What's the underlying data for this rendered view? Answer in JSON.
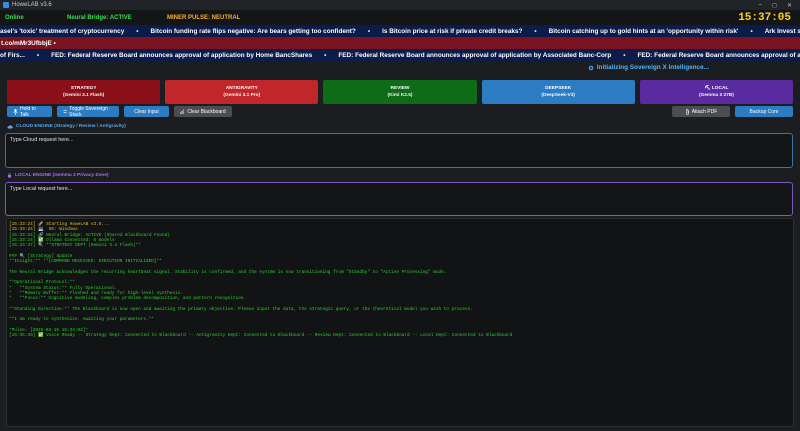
{
  "window": {
    "title": "HoweLAB v3.6",
    "controls": [
      "–",
      "◻",
      "✕"
    ]
  },
  "status": {
    "online": "Online",
    "neural_bridge": "Neural Bridge: ACTIVE",
    "miner_pulse": "MINER PULSE: NEUTRAL",
    "clock": "15:37:05"
  },
  "ticker1": [
    "asel's 'toxic' treatment of cryptocurrency",
    "Bitcoin funding rate flips negative: Are bears getting too confident?",
    "Is Bitcoin price at risk if private credit breaks?",
    "Bitcoin catching up to gold hints at an 'opportunity within risk'",
    "Ark Invest sees one-third o"
  ],
  "ticker_sep": "•",
  "url_text": "t.co/mMr3UfbbjE •",
  "ticker2": [
    "of Firs...",
    "FED: Federal Reserve Board announces approval of application by Home BancShares",
    "FED: Federal Reserve Board announces approval of application by Associated Banc-Corp",
    "FED: Federal Reserve Board announces approval of a"
  ],
  "init_text": "Initializing Sovereign X Intelligence...",
  "departments": [
    {
      "name": "STRATEGY",
      "model": "(Gemini 3.1 Flash)",
      "color": "#8b0f18",
      "icon": ""
    },
    {
      "name": "ANTIGRAVITY",
      "model": "(Gemini 3.1 Pro)",
      "color": "#c0262a",
      "icon": ""
    },
    {
      "name": "REVIEW",
      "model": "(Kimi K2.5)",
      "color": "#0e6b18",
      "icon": ""
    },
    {
      "name": "DEEPSEEK",
      "model": "(DeepSeek-V3)",
      "color": "#2c7cc4",
      "icon": ""
    },
    {
      "name": "LOCAL",
      "model": "(Gemma 3 27B)",
      "color": "#5a2ba0",
      "icon": "⛏"
    }
  ],
  "actions": {
    "hold_to_talk": "Hold to Talk",
    "toggle_stack": "Toggle Sovereign Stack",
    "clear_input": "Clear Input",
    "clear_blackboard": "Clear Blackboard",
    "attach_pdf": "Attach PDF",
    "backup_core": "Backup Core"
  },
  "cloud_label": "CLOUD ENGINE (Strategy / Review / Antigravity)",
  "cloud_placeholder": "Type Cloud request here...",
  "local_label": "LOCAL ENGINE (Gemma 3 Privacy Zone)",
  "local_placeholder": "Type Local request here...",
  "console_lines": [
    {
      "text": "[15:33:24] 🚀 Starting HoweLAB v3.6...",
      "color": "yellow"
    },
    {
      "text": "[15:33:24] 💻  OS: Windows",
      "color": "yellow"
    },
    {
      "text": "[15:33:24] 🔗 Neural Bridge: ACTIVE (Shared Blackboard Found)",
      "color": "green"
    },
    {
      "text": "[15:33:24] ✅ Ollama Connected: 6 models",
      "color": "green"
    },
    {
      "text": "[15:33:37] 🔍 **STRATEGY DEPT (Gemini 3.1 Flash)**",
      "color": "green"
    },
    {
      "text": "",
      "color": "green"
    },
    {
      "text": "### 🔍 [Strategy] Update",
      "color": "green"
    },
    {
      "text": "**Insight:** **[COMMAND RECEIVED: EXECUTION INITIALIZED]**",
      "color": "green"
    },
    {
      "text": "",
      "color": "green"
    },
    {
      "text": "The Neural Bridge acknowledges the recurring heartbeat signal. Stability is confirmed, and the system is now transitioning from \"Standby\" to \"Active Processing\" mode.",
      "color": "green"
    },
    {
      "text": "",
      "color": "green"
    },
    {
      "text": "**Operational Protocol:**",
      "color": "green"
    },
    {
      "text": "*   **System Status:** Fully Operational.",
      "color": "green"
    },
    {
      "text": "*   **Memory Buffer:** Flushed and ready for high-level synthesis.",
      "color": "green"
    },
    {
      "text": "*   **Focus:** Cognitive modeling, complex problem decomposition, and pattern recognition.",
      "color": "green"
    },
    {
      "text": "",
      "color": "green"
    },
    {
      "text": "**Standing Directive:** The Blackboard is now open and awaiting the primary objective. Please input the data, the strategic query, or the theoretical model you wish to process.",
      "color": "green"
    },
    {
      "text": "",
      "color": "green"
    },
    {
      "text": "**I am ready to synthesize. Awaiting your parameters.**",
      "color": "green"
    },
    {
      "text": "",
      "color": "green"
    },
    {
      "text": "*Pulse: [2026-03-15 15:34:02]*",
      "color": "green"
    },
    {
      "text": "[15:35:39] ✅ Voice Ready -- Strategy Dept: Connected to Blackboard -- Antigravity Dept: Connected to Blackboard -- Review Dept: Connected to Blackboard -- Local Dept: Connected to Blackboard",
      "color": "green"
    }
  ]
}
